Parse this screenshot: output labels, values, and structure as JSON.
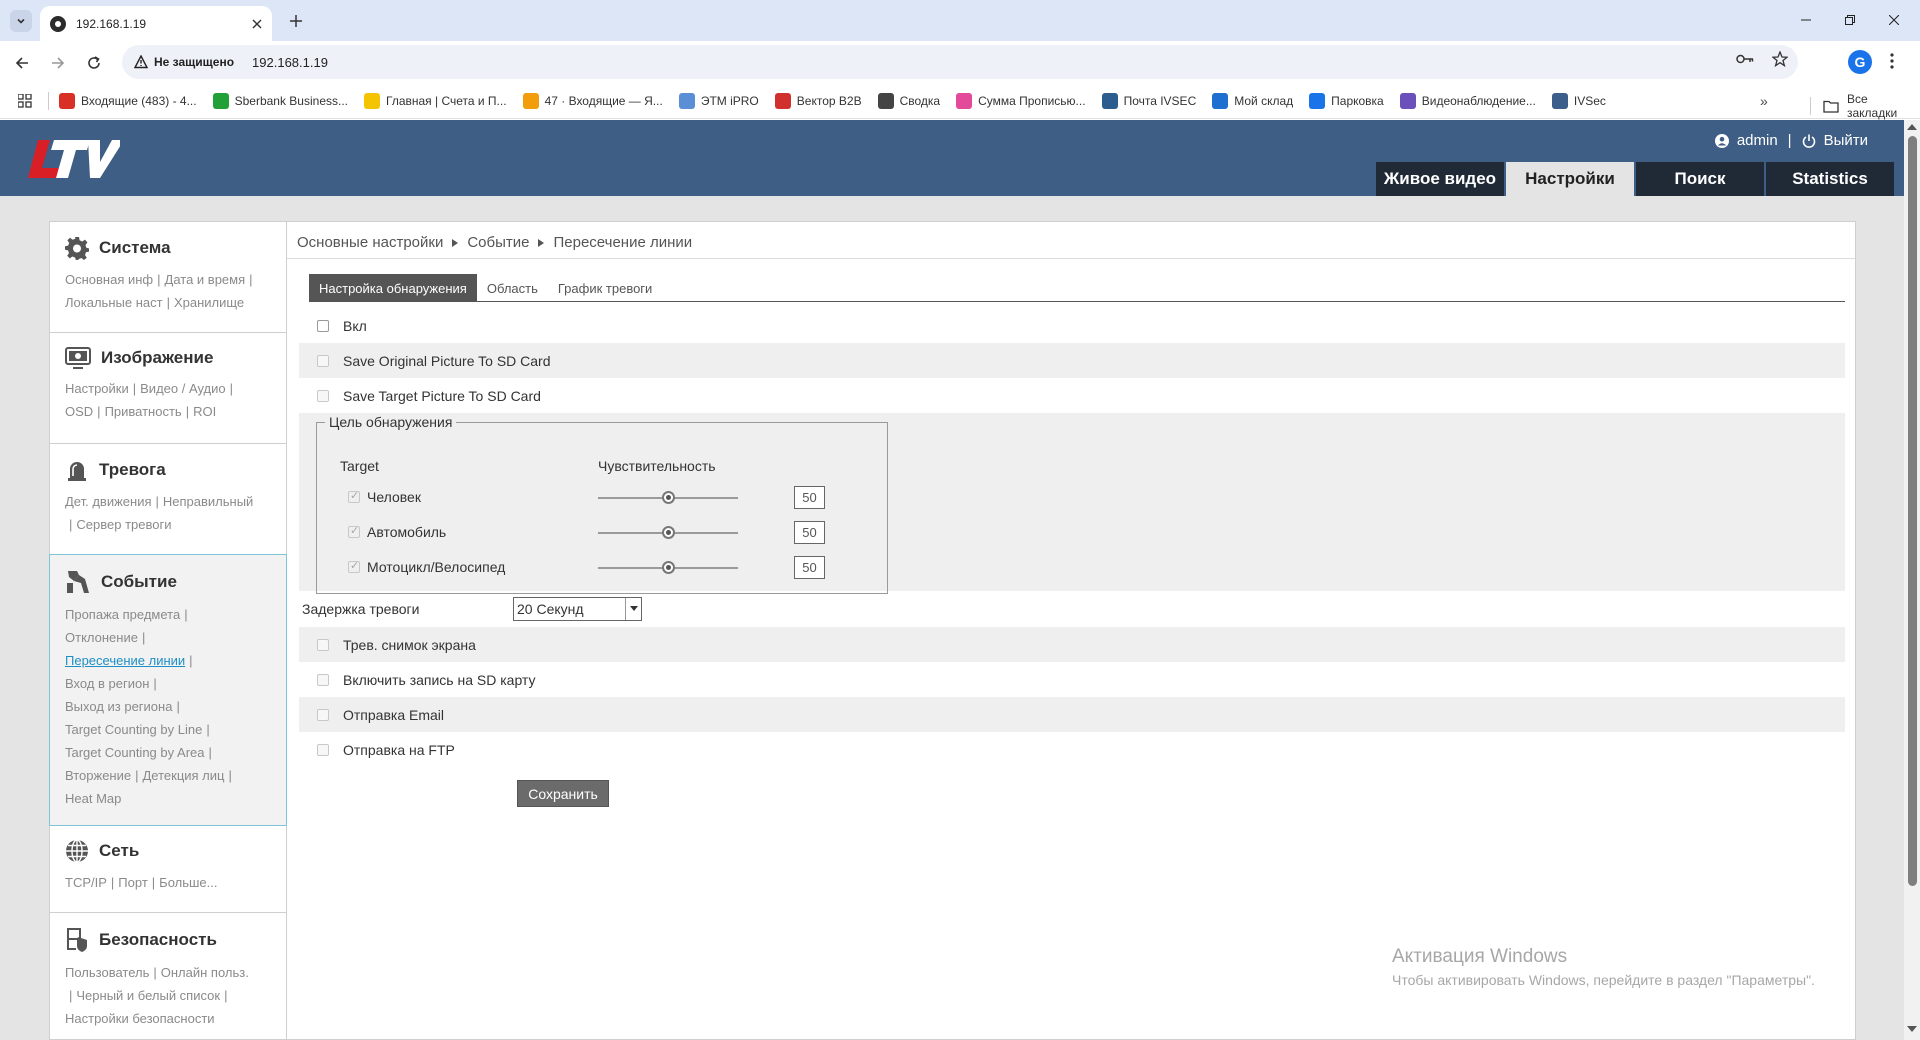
{
  "browser": {
    "tab_title": "192.168.1.19",
    "security_label": "Не защищено",
    "url": "192.168.1.19",
    "profile_letter": "G",
    "bookmarks": [
      {
        "label": "Входящие (483) - 4...",
        "icon": "gmail-icon",
        "color": "#d93025"
      },
      {
        "label": "Sberbank Business...",
        "icon": "sberbank-icon",
        "color": "#21a038"
      },
      {
        "label": "Главная | Счета и П...",
        "icon": "tochka-icon",
        "color": "#f5c400"
      },
      {
        "label": "47 · Входящие — Я...",
        "icon": "mail-icon",
        "color": "#f29d0b"
      },
      {
        "label": "ЭТМ iPRO",
        "icon": "etm-icon",
        "color": "#5a8fd6"
      },
      {
        "label": "Вектор B2B",
        "icon": "vector-icon",
        "color": "#d0312d"
      },
      {
        "label": "Сводка",
        "icon": "svodka-icon",
        "color": "#444444"
      },
      {
        "label": "Сумма Прописью...",
        "icon": "summa-icon",
        "color": "#e34a9a"
      },
      {
        "label": "Почта IVSEC",
        "icon": "ivsec-mail-icon",
        "color": "#2d5d8f"
      },
      {
        "label": "Мой склад",
        "icon": "sklad-icon",
        "color": "#1f6fd1"
      },
      {
        "label": "Парковка",
        "icon": "parking-icon",
        "color": "#1a73e8"
      },
      {
        "label": "Видеонаблюдение...",
        "icon": "video-icon",
        "color": "#6b4fbb"
      },
      {
        "label": "IVSec",
        "icon": "ivsec-icon",
        "color": "#3b5f8a"
      }
    ],
    "more": "»",
    "all_bookmarks": "Все закладки"
  },
  "header": {
    "user": "admin",
    "logout": "Выйти",
    "tabs": [
      {
        "label": "Живое видео",
        "active": false
      },
      {
        "label": "Настройки",
        "active": true
      },
      {
        "label": "Поиск",
        "active": false
      },
      {
        "label": "Statistics",
        "active": false
      }
    ]
  },
  "sidebar": {
    "sections": [
      {
        "title": "Система",
        "icon": "gear-icon",
        "links": [
          "Основная инф",
          "Дата и время",
          "Локальные наст",
          "Хранилище"
        ]
      },
      {
        "title": "Изображение",
        "icon": "monitor-icon",
        "links": [
          "Настройки",
          "Видео / Аудио",
          "OSD",
          "Приватность",
          "ROI"
        ]
      },
      {
        "title": "Тревога",
        "icon": "alarm-icon",
        "links": [
          "Дет. движения",
          "Неправильный",
          "Сервер тревоги"
        ]
      },
      {
        "title": "Событие",
        "icon": "event-icon",
        "links": [
          "Пропажа предмета",
          "Отклонение",
          "Пересечение линии",
          "Вход в регион",
          "Выход из региона",
          "Target Counting by Line",
          "Target Counting by Area",
          "Вторжение",
          "Детекция лиц",
          "Heat Map"
        ]
      },
      {
        "title": "Сеть",
        "icon": "globe-icon",
        "links": [
          "TCP/IP",
          "Порт",
          "Больше..."
        ]
      },
      {
        "title": "Безопасность",
        "icon": "security-icon",
        "links": [
          "Пользователь",
          "Онлайн польз.",
          "Черный и белый список",
          "Настройки безопасности"
        ]
      }
    ]
  },
  "breadcrumb": [
    "Основные настройки",
    "Событие",
    "Пересечение линии"
  ],
  "subtabs": [
    {
      "label": "Настройка обнаружения",
      "active": true
    },
    {
      "label": "Область",
      "active": false
    },
    {
      "label": "График тревоги",
      "active": false
    }
  ],
  "options": {
    "enable": "Вкл",
    "save_original": "Save Original Picture To SD Card",
    "save_target": "Save Target Picture To SD Card"
  },
  "detection_target": {
    "legend": "Цель обнаружения",
    "col_target": "Target",
    "col_sensitivity": "Чувствительность",
    "targets": [
      {
        "label": "Человек",
        "checked": true,
        "value": "50",
        "level": 50
      },
      {
        "label": "Автомобиль",
        "checked": true,
        "value": "50",
        "level": 50
      },
      {
        "label": "Мотоцикл/Велосипед",
        "checked": true,
        "value": "50",
        "level": 50
      }
    ]
  },
  "alarm_delay": {
    "label": "Задержка тревоги",
    "value": "20 Секунд"
  },
  "actions": {
    "snapshot": "Трев. снимок экрана",
    "sd_record": "Включить запись на SD карту",
    "email": "Отправка Email",
    "ftp": "Отправка на FTP"
  },
  "save_label": "Сохранить",
  "watermark": {
    "title": "Активация Windows",
    "subtitle": "Чтобы активировать Windows, перейдите в раздел \"Параметры\"."
  }
}
